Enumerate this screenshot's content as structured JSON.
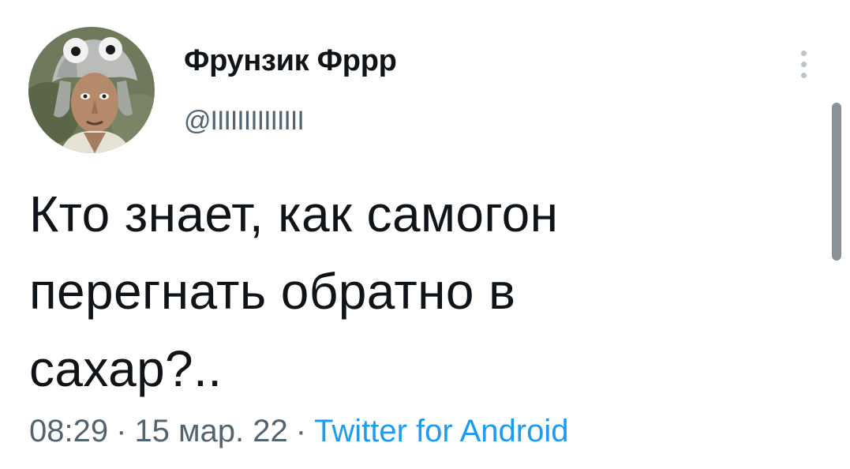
{
  "tweet": {
    "display_name": "Фрунзик Фррр",
    "handle": "@IIIIIIIIIIIIII",
    "text_lines": [
      "Кто знает, как самогон",
      "перегнать обратно в",
      "сахар?.."
    ],
    "time": "08:29",
    "date": "15 мар. 22",
    "separator": "·",
    "source": "Twitter for Android"
  },
  "icons": {
    "more": "more-vertical-icon"
  },
  "colors": {
    "text": "#0f1419",
    "secondary": "#536471",
    "accent": "#1d9bf0"
  }
}
